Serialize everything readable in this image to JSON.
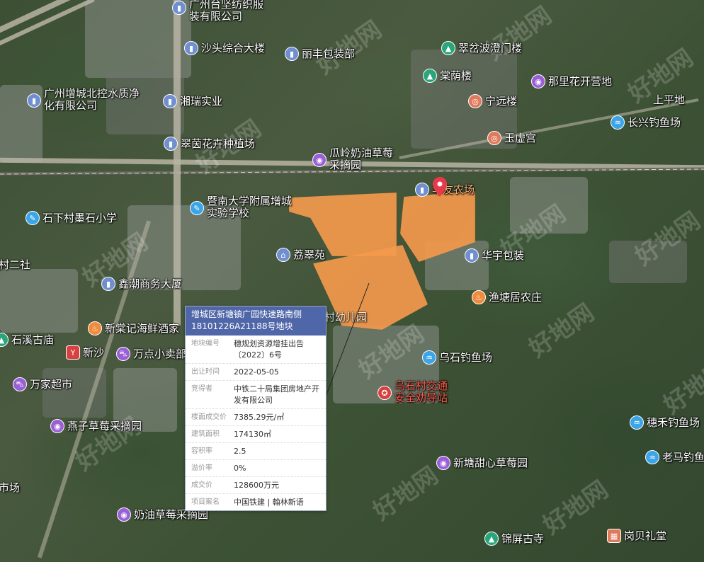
{
  "popup": {
    "title": "增城区新塘镇广园快速路南侧18101226A21188号地块",
    "rows": [
      {
        "key": "地块编号",
        "value": "穗规划资源增挂出告〔2022〕6号"
      },
      {
        "key": "出让时间",
        "value": "2022-05-05"
      },
      {
        "key": "竞得者",
        "value": "中铁二十局集团房地产开发有限公司"
      },
      {
        "key": "楼面成交价",
        "value": "7385.29元/㎡"
      },
      {
        "key": "建筑面积",
        "value": "174130㎡"
      },
      {
        "key": "容积率",
        "value": "2.5"
      },
      {
        "key": "溢价率",
        "value": "0%"
      },
      {
        "key": "成交价",
        "value": "128600万元"
      },
      {
        "key": "项目案名",
        "value": "中国铁建 | 翰林新语"
      }
    ]
  },
  "pois": [
    {
      "label": "广州台坚纺织服装有限公司",
      "icon": "building-icon"
    },
    {
      "label": "沙头综合大楼",
      "icon": "building-icon"
    },
    {
      "label": "丽丰包装部",
      "icon": "building-icon"
    },
    {
      "label": "翠岔波澄门楼",
      "icon": "tree-icon"
    },
    {
      "label": "棠荫楼",
      "icon": "tree-icon"
    },
    {
      "label": "那里花开营地",
      "icon": "game-icon"
    },
    {
      "label": "广州增城北控水质净化有限公司",
      "icon": "building-icon"
    },
    {
      "label": "湘瑞实业",
      "icon": "building-icon"
    },
    {
      "label": "宁远楼",
      "icon": "camera-icon"
    },
    {
      "label": "上平地",
      "icon": ""
    },
    {
      "label": "长兴钓鱼场",
      "icon": "fishing-icon"
    },
    {
      "label": "玉虚宫",
      "icon": "camera-icon"
    },
    {
      "label": "翠茵花卉种植场",
      "icon": "building-icon"
    },
    {
      "label": "瓜岭奶油草莓采摘园",
      "icon": "game-icon"
    },
    {
      "label": "暨南大学附属增城实验学校",
      "icon": "school-icon"
    },
    {
      "label": "华友农场",
      "icon": "building-icon"
    },
    {
      "label": "石下村墨石小学",
      "icon": "school-icon"
    },
    {
      "label": "荔翠苑",
      "icon": "residence-icon"
    },
    {
      "label": "华宇包装",
      "icon": "building-icon"
    },
    {
      "label": "村二社",
      "icon": ""
    },
    {
      "label": "鑫潮商务大厦",
      "icon": "building-icon"
    },
    {
      "label": "渔塘居农庄",
      "icon": "food-icon"
    },
    {
      "label": "新棠记海鲜酒家",
      "icon": "food-icon"
    },
    {
      "label": "石溪古庙",
      "icon": "tree-icon"
    },
    {
      "label": "新沙",
      "icon": "metro-icon"
    },
    {
      "label": "万点小卖部",
      "icon": "shop-icon"
    },
    {
      "label": "乌石钓鱼场",
      "icon": "fishing-icon"
    },
    {
      "label": "万家超市",
      "icon": "shop-icon"
    },
    {
      "label": "乌石村交通安全劝导站",
      "icon": "police-icon"
    },
    {
      "label": "燕子草莓采摘园",
      "icon": "game-icon"
    },
    {
      "label": "穗禾钓鱼场",
      "icon": "fishing-icon"
    },
    {
      "label": "新塘甜心草莓园",
      "icon": "game-icon"
    },
    {
      "label": "老马钓鱼",
      "icon": "fishing-icon"
    },
    {
      "label": "市场",
      "icon": ""
    },
    {
      "label": "奶油草莓采摘园",
      "icon": "game-icon"
    },
    {
      "label": "锦屏古寺",
      "icon": "tree-icon"
    },
    {
      "label": "岗贝礼堂",
      "icon": "hall-icon"
    },
    {
      "label": "村幼儿园",
      "icon": ""
    }
  ],
  "watermark": "好地网"
}
